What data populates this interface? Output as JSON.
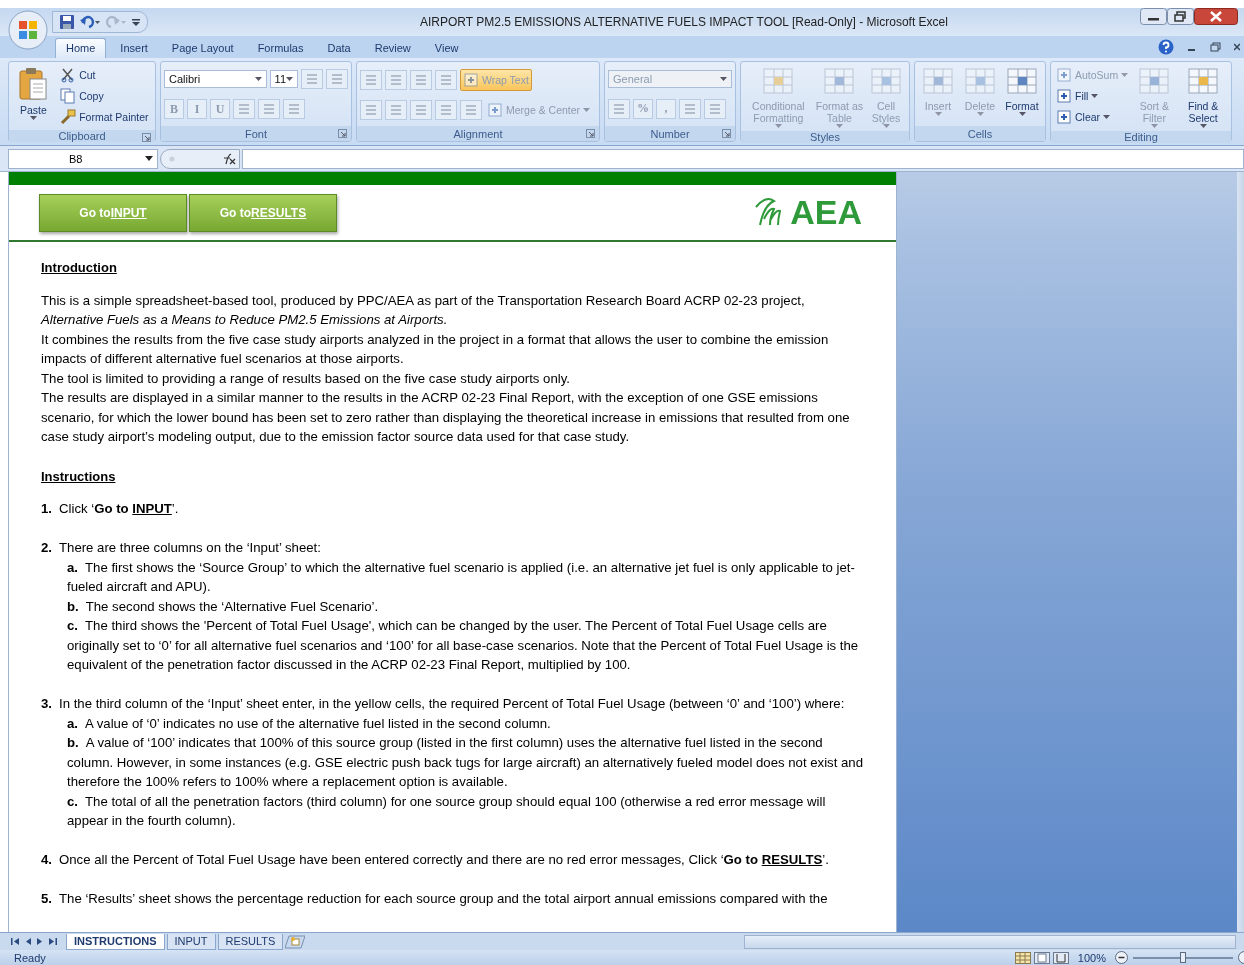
{
  "window": {
    "title": "AIRPORT PM2.5 EMISSIONS  ALTERNATIVE FUELS IMPACT TOOL  [Read-Only] - Microsoft Excel"
  },
  "ribbon_tabs": [
    {
      "label": "Home",
      "selected": true
    },
    {
      "label": "Insert",
      "selected": false
    },
    {
      "label": "Page Layout",
      "selected": false
    },
    {
      "label": "Formulas",
      "selected": false
    },
    {
      "label": "Data",
      "selected": false
    },
    {
      "label": "Review",
      "selected": false
    },
    {
      "label": "View",
      "selected": false
    }
  ],
  "ribbon_groups": [
    {
      "label": "Clipboard",
      "launcher": true,
      "stacks": [
        [
          {
            "kind": "large",
            "label": "Paste",
            "menu": true,
            "disabled": false
          }
        ],
        [
          {
            "kind": "small",
            "label": "Cut",
            "disabled": false
          },
          {
            "kind": "small",
            "label": "Copy",
            "disabled": false
          },
          {
            "kind": "small",
            "label": "Format Painter",
            "disabled": false
          }
        ]
      ]
    },
    {
      "label": "Font",
      "launcher": true,
      "strips": [
        [
          {
            "kind": "combo",
            "value": "Calibri"
          },
          {
            "kind": "combo",
            "value": "11"
          },
          {
            "kind": "tool",
            "disabled": true
          },
          {
            "kind": "tool",
            "disabled": true
          }
        ],
        [
          {
            "kind": "glyph",
            "label": "B",
            "disabled": true
          },
          {
            "kind": "glyph",
            "label": "I",
            "disabled": true
          },
          {
            "kind": "glyph",
            "label": "U",
            "disabled": true
          },
          {
            "kind": "tool",
            "disabled": true
          },
          {
            "kind": "tool",
            "disabled": true
          },
          {
            "kind": "tool",
            "disabled": true
          }
        ]
      ]
    },
    {
      "label": "Alignment",
      "launcher": true,
      "strips": [
        [
          {
            "kind": "tool",
            "disabled": true
          },
          {
            "kind": "tool",
            "disabled": true
          },
          {
            "kind": "tool",
            "disabled": true
          },
          {
            "kind": "tool",
            "disabled": true
          },
          {
            "kind": "small",
            "label": "Wrap Text",
            "disabled": true,
            "on": true
          }
        ],
        [
          {
            "kind": "tool",
            "disabled": true
          },
          {
            "kind": "tool",
            "disabled": true
          },
          {
            "kind": "tool",
            "disabled": true
          },
          {
            "kind": "tool",
            "disabled": true
          },
          {
            "kind": "tool",
            "disabled": true
          },
          {
            "kind": "small",
            "label": "Merge & Center",
            "menu": true,
            "disabled": true,
            "on": false
          }
        ]
      ]
    },
    {
      "label": "Number",
      "launcher": true,
      "strips": [
        [
          {
            "kind": "combo",
            "value": "General",
            "disabled": true
          }
        ],
        [
          {
            "kind": "tool",
            "disabled": true
          },
          {
            "kind": "glyph",
            "label": "%",
            "disabled": true
          },
          {
            "kind": "glyph",
            "label": ",",
            "disabled": true
          },
          {
            "kind": "tool",
            "disabled": true
          },
          {
            "kind": "tool",
            "disabled": true
          }
        ]
      ]
    },
    {
      "label": "Styles",
      "stacks": [
        [
          {
            "kind": "large",
            "label": "Conditional Formatting",
            "menu": true,
            "disabled": true
          }
        ],
        [
          {
            "kind": "large",
            "label": "Format as Table",
            "menu": true,
            "disabled": true
          }
        ],
        [
          {
            "kind": "large",
            "label": "Cell Styles",
            "menu": true,
            "disabled": true
          }
        ]
      ]
    },
    {
      "label": "Cells",
      "stacks": [
        [
          {
            "kind": "large",
            "label": "Insert",
            "menu": true,
            "disabled": true
          }
        ],
        [
          {
            "kind": "large",
            "label": "Delete",
            "menu": true,
            "disabled": true
          }
        ],
        [
          {
            "kind": "large",
            "label": "Format",
            "menu": true,
            "disabled": false
          }
        ]
      ]
    },
    {
      "label": "Editing",
      "stacks": [
        [
          {
            "kind": "small",
            "label": "AutoSum",
            "menu": true,
            "disabled": true
          },
          {
            "kind": "small",
            "label": "Fill",
            "menu": true,
            "disabled": false
          },
          {
            "kind": "small",
            "label": "Clear",
            "menu": true,
            "disabled": false
          }
        ],
        [
          {
            "kind": "large",
            "label": "Sort & Filter",
            "menu": true,
            "disabled": true
          }
        ],
        [
          {
            "kind": "large",
            "label": "Find & Select",
            "menu": true,
            "disabled": false
          }
        ]
      ]
    }
  ],
  "formula_bar": {
    "name_box": "B8"
  },
  "sheet": {
    "buttons": [
      {
        "parts": [
          {
            "text": "Go to "
          },
          {
            "text": "INPUT",
            "underline": true
          }
        ]
      },
      {
        "parts": [
          {
            "text": "Go to "
          },
          {
            "text": "RESULTS",
            "underline": true
          }
        ]
      }
    ],
    "logo": "AEA",
    "sections": [
      {
        "heading": "Introduction",
        "paragraphs": [
          [
            {
              "text": "This is a simple spreadsheet-based tool, produced by PPC/AEA as part of the Transportation Research Board ACRP 02-23 project,"
            }
          ],
          [
            {
              "text": "Alternative Fuels as a Means to Reduce PM2.5 Emissions at Airports.",
              "italic": true
            }
          ],
          [
            {
              "text": "It combines the results from the five case study airports analyzed in the project in a format that allows the user to combine the emission impacts of different alternative fuel scenarios at those airports."
            }
          ],
          [
            {
              "text": "The tool is limited to providing a range of results based on the five case study airports only."
            }
          ],
          [
            {
              "text": "The results are displayed in a similar manner to the results in the ACRP 02-23 Final Report, with the exception of one GSE emissions scenario, for which the lower bound has been set to zero rather than displaying the theoretical increase in emissions that resulted from one case study airport’s modeling output, due to the emission factor source data used for that case study."
            }
          ]
        ]
      },
      {
        "heading": "Instructions",
        "steps": [
          {
            "number": "1.",
            "parts": [
              {
                "text": "Click ‘"
              },
              {
                "text": "Go to ",
                "bold": true
              },
              {
                "text": "INPUT",
                "bold": true,
                "underline": true
              },
              {
                "text": "’."
              }
            ]
          },
          {
            "number": "2.",
            "parts": [
              {
                "text": "There are three columns on the ‘Input’ sheet:"
              }
            ],
            "substeps": [
              {
                "letter": "a.",
                "text": "The first shows the ‘Source Group’ to which the alternative fuel scenario is applied (i.e. an alternative jet fuel is only applicable to jet-fueled aircraft and APU)."
              },
              {
                "letter": "b.",
                "text": "The second shows the ‘Alternative Fuel Scenario’."
              },
              {
                "letter": "c.",
                "text": "The third shows the 'Percent of Total Fuel Usage', which can be changed by the user. The Percent of Total Fuel Usage cells are originally set to ‘0’ for all alternative fuel scenarios and ‘100’ for all base-case scenarios. Note that the Percent of Total Fuel Usage is the equivalent of the penetration factor discussed in the ACRP 02-23 Final Report, multiplied by 100."
              }
            ]
          },
          {
            "number": "3.",
            "parts": [
              {
                "text": "In the third column of the ‘Input’ sheet enter, in the yellow cells, the required Percent of Total Fuel Usage (between ‘0’ and ‘100’) where:"
              }
            ],
            "substeps": [
              {
                "letter": "a.",
                "text": "A value of ‘0’ indicates no use of the alternative fuel listed in the second column."
              },
              {
                "letter": "b.",
                "text": "A value of ‘100’ indicates that 100% of this source group (listed in the first column) uses the alternative fuel listed in the second column. However, in some instances (e.g. GSE electric push back tugs for large aircraft) an alternatively fueled model does not exist and therefore the 100% refers to 100% where a replacement option is available."
              },
              {
                "letter": "c.",
                "text": "The total of all the penetration factors (third column) for one source group should equal 100 (otherwise a red error message will appear in the fourth column)."
              }
            ]
          },
          {
            "number": "4.",
            "parts": [
              {
                "text": "Once all the Percent of Total Fuel Usage have been entered correctly and there are no red error messages, Click ‘"
              },
              {
                "text": "Go to ",
                "bold": true
              },
              {
                "text": "RESULTS",
                "bold": true,
                "underline": true
              },
              {
                "text": "’."
              }
            ]
          },
          {
            "number": "5.",
            "parts": [
              {
                "text": "The ‘Results’ sheet shows the percentage reduction for each source group and the total airport annual emissions compared with the"
              }
            ]
          }
        ]
      }
    ]
  },
  "sheet_tabs": [
    {
      "label": "INSTRUCTIONS",
      "selected": true
    },
    {
      "label": "INPUT",
      "selected": false
    },
    {
      "label": "RESULTS",
      "selected": false
    }
  ],
  "status_bar": {
    "status": "Ready",
    "zoom": "100%",
    "zoom_slider": {
      "level": 0.5
    }
  }
}
